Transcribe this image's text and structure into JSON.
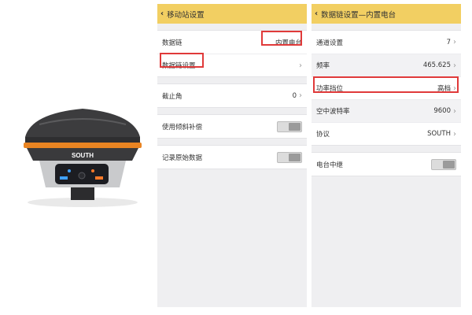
{
  "colors": {
    "header_bg": "#f2cf62",
    "highlight": "#e03a3a",
    "brand_orange": "#e98422"
  },
  "device": {
    "brand": "SOUTH"
  },
  "screen1": {
    "title": "移动站设置",
    "back_icon": "chevron-left-icon",
    "rows": [
      {
        "label": "数据链",
        "value": "内置电台"
      },
      {
        "label": "数据链设置",
        "value": ""
      },
      {
        "label": "截止角",
        "value": "0"
      },
      {
        "label": "使用倾斜补偿",
        "toggle": "off"
      },
      {
        "label": "记录原始数据",
        "toggle": "off"
      }
    ]
  },
  "screen2": {
    "title": "数据链设置—内置电台",
    "back_icon": "chevron-left-icon",
    "rows": [
      {
        "label": "通道设置",
        "value": "7"
      },
      {
        "label": "频率",
        "value": "465.625"
      },
      {
        "label": "功率挡位",
        "value": "高档"
      },
      {
        "label": "空中波特率",
        "value": "9600"
      },
      {
        "label": "协议",
        "value": "SOUTH"
      },
      {
        "label": "电台中继",
        "toggle": "off"
      }
    ]
  }
}
